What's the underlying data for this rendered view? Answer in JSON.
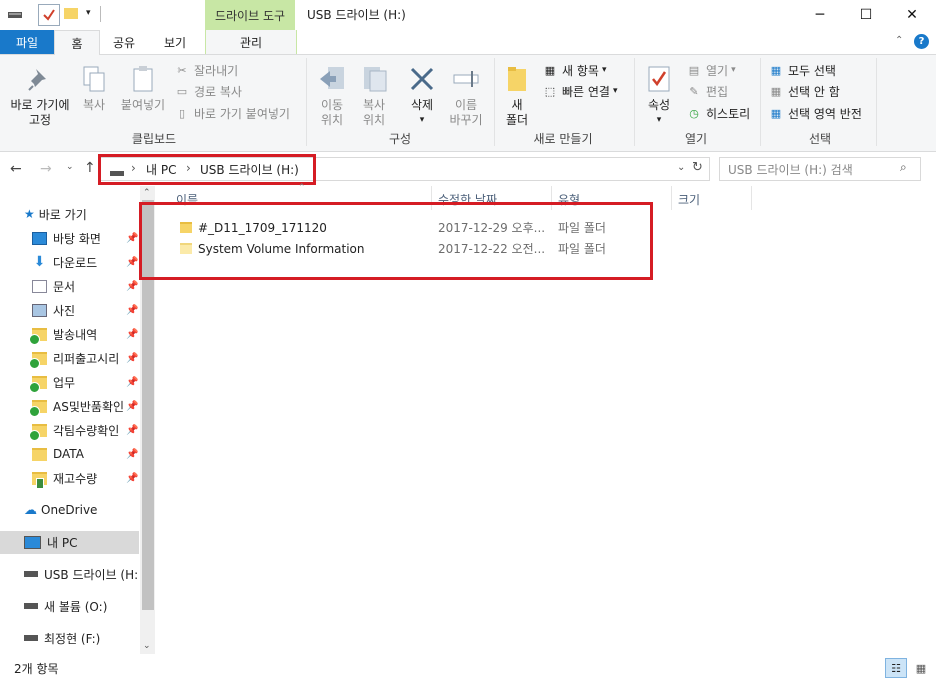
{
  "window": {
    "title": "USB 드라이브 (H:)",
    "context_tab": "드라이브 도구",
    "minimize": "─",
    "maximize": "☐",
    "close": "✕"
  },
  "tabs": {
    "file": "파일",
    "home": "홈",
    "share": "공유",
    "view": "보기",
    "manage": "관리"
  },
  "ribbon": {
    "clipboard": {
      "label": "클립보드",
      "pin_quick_1": "바로 가기에",
      "pin_quick_2": "고정",
      "copy": "복사",
      "paste": "붙여넣기",
      "cut": "잘라내기",
      "copy_path": "경로 복사",
      "paste_shortcut": "바로 가기 붙여넣기"
    },
    "organize": {
      "label": "구성",
      "move_1": "이동",
      "move_2": "위치",
      "copy_1": "복사",
      "copy_2": "위치",
      "delete": "삭제",
      "rename_1": "이름",
      "rename_2": "바꾸기"
    },
    "new": {
      "label": "새로 만들기",
      "new_folder_1": "새",
      "new_folder_2": "폴더",
      "new_item": "새 항목",
      "easy_access": "빠른 연결"
    },
    "open": {
      "label": "열기",
      "properties": "속성",
      "open": "열기",
      "edit": "편집",
      "history": "히스토리"
    },
    "select": {
      "label": "선택",
      "select_all": "모두 선택",
      "select_none": "선택 안 함",
      "invert": "선택 영역 반전"
    }
  },
  "address": {
    "crumbs": [
      "내 PC",
      "USB 드라이브 (H:)"
    ],
    "sep": "›",
    "search_placeholder": "USB 드라이브 (H:) 검색"
  },
  "columns": {
    "name": "이름",
    "date": "수정한 날짜",
    "type": "유형",
    "size": "크기"
  },
  "files": [
    {
      "name": "#_D11_1709_171120",
      "date": "2017-12-29 오후...",
      "type": "파일 폴더",
      "size": ""
    },
    {
      "name": "System Volume Information",
      "date": "2017-12-22 오전...",
      "type": "파일 폴더",
      "size": ""
    }
  ],
  "nav": {
    "quick_access": "바로 가기",
    "pinned": [
      {
        "label": "바탕 화면",
        "icon": "desktop-icon"
      },
      {
        "label": "다운로드",
        "icon": "download-icon"
      },
      {
        "label": "문서",
        "icon": "documents-icon"
      },
      {
        "label": "사진",
        "icon": "pictures-icon"
      },
      {
        "label": "발송내역",
        "icon": "folder-icon"
      },
      {
        "label": "리퍼출고시리",
        "icon": "folder-icon"
      },
      {
        "label": "업무",
        "icon": "folder-icon"
      },
      {
        "label": "AS및반품확인",
        "icon": "folder-icon"
      },
      {
        "label": "각팀수량확인",
        "icon": "folder-icon"
      },
      {
        "label": "DATA",
        "icon": "folder-icon"
      },
      {
        "label": "재고수량",
        "icon": "folder-icon"
      }
    ],
    "onedrive": "OneDrive",
    "this_pc": "내 PC",
    "drives": [
      "USB 드라이브 (H:",
      "새 볼륨 (O:)",
      "최정현 (F:)"
    ]
  },
  "status": {
    "items": "2개 항목"
  },
  "colors": {
    "accent": "#1979ca",
    "highlight": "#d51c24",
    "context": "#c8e7a5"
  }
}
